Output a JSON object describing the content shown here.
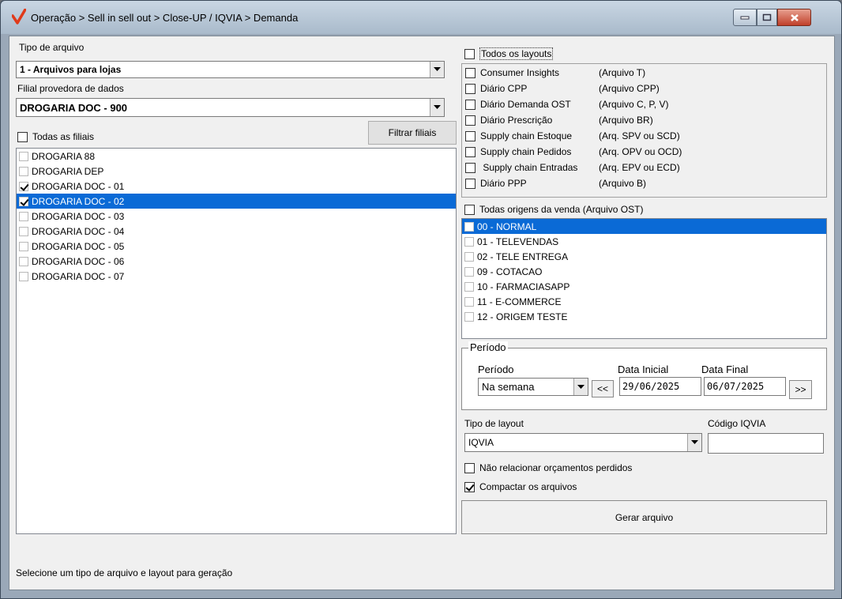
{
  "window": {
    "title": "Operação > Sell in sell out > Close-UP / IQVIA > Demanda"
  },
  "left": {
    "file_type_label": "Tipo de arquivo",
    "file_type_value": "1 - Arquivos para lojas",
    "provider_label": "Filial provedora de dados",
    "provider_value": "DROGARIA DOC - 900",
    "all_branches_label": "Todas as filiais",
    "all_branches_checked": false,
    "filter_button": "Filtrar filiais",
    "branches": [
      {
        "label": "DROGARIA 88",
        "checked": false,
        "selected": false
      },
      {
        "label": "DROGARIA DEP",
        "checked": false,
        "selected": false
      },
      {
        "label": "DROGARIA DOC - 01",
        "checked": true,
        "selected": false
      },
      {
        "label": "DROGARIA DOC - 02",
        "checked": true,
        "selected": true
      },
      {
        "label": "DROGARIA DOC - 03",
        "checked": false,
        "selected": false
      },
      {
        "label": "DROGARIA DOC - 04",
        "checked": false,
        "selected": false
      },
      {
        "label": "DROGARIA DOC - 05",
        "checked": false,
        "selected": false
      },
      {
        "label": "DROGARIA DOC - 06",
        "checked": false,
        "selected": false
      },
      {
        "label": "DROGARIA DOC - 07",
        "checked": false,
        "selected": false
      }
    ]
  },
  "layouts": {
    "all_label": "Todos os layouts",
    "items": [
      {
        "name": "Consumer Insights",
        "file": "(Arquivo T)"
      },
      {
        "name": "Diário CPP",
        "file": "(Arquivo CPP)"
      },
      {
        "name": "Diário Demanda OST",
        "file": "(Arquivo C, P, V)"
      },
      {
        "name": "Diário Prescrição",
        "file": "(Arquivo BR)"
      },
      {
        "name": "Supply chain Estoque",
        "file": "(Arq. SPV ou SCD)"
      },
      {
        "name": "Supply chain Pedidos",
        "file": "(Arq. OPV ou OCD)"
      },
      {
        "name": " Supply chain Entradas",
        "file": "(Arq. EPV ou ECD)"
      },
      {
        "name": "Diário PPP",
        "file": "(Arquivo B)"
      }
    ]
  },
  "origins": {
    "all_label": "Todas origens da venda (Arquivo OST)",
    "items": [
      {
        "label": "00 - NORMAL",
        "selected": true
      },
      {
        "label": "01 - TELEVENDAS",
        "selected": false
      },
      {
        "label": "02 - TELE ENTREGA",
        "selected": false
      },
      {
        "label": "09 - COTACAO",
        "selected": false
      },
      {
        "label": "10 - FARMACIASAPP",
        "selected": false
      },
      {
        "label": "11 - E-COMMERCE",
        "selected": false
      },
      {
        "label": "12 - ORIGEM TESTE",
        "selected": false
      }
    ]
  },
  "period": {
    "group_title": "Período",
    "period_label": "Período",
    "period_value": "Na semana",
    "start_label": "Data Inicial",
    "start_value": "29/06/2025",
    "end_label": "Data Final",
    "end_value": "06/07/2025",
    "prev_button": "<<",
    "next_button": ">>"
  },
  "layout_type": {
    "label": "Tipo de layout",
    "value": "IQVIA",
    "iqvia_code_label": "Código IQVIA",
    "iqvia_code_value": ""
  },
  "options": {
    "no_lost_quotes_label": "Não relacionar orçamentos perdidos",
    "no_lost_quotes_checked": false,
    "compress_label": "Compactar os arquivos",
    "compress_checked": true
  },
  "generate_button": "Gerar arquivo",
  "status_text": "Selecione um tipo de arquivo e layout para geração",
  "colors": {
    "selection": "#0a6ad6",
    "title_gradient_top": "#c9d6e3",
    "close_button": "#c0402a",
    "logo": "#e03a1a"
  }
}
